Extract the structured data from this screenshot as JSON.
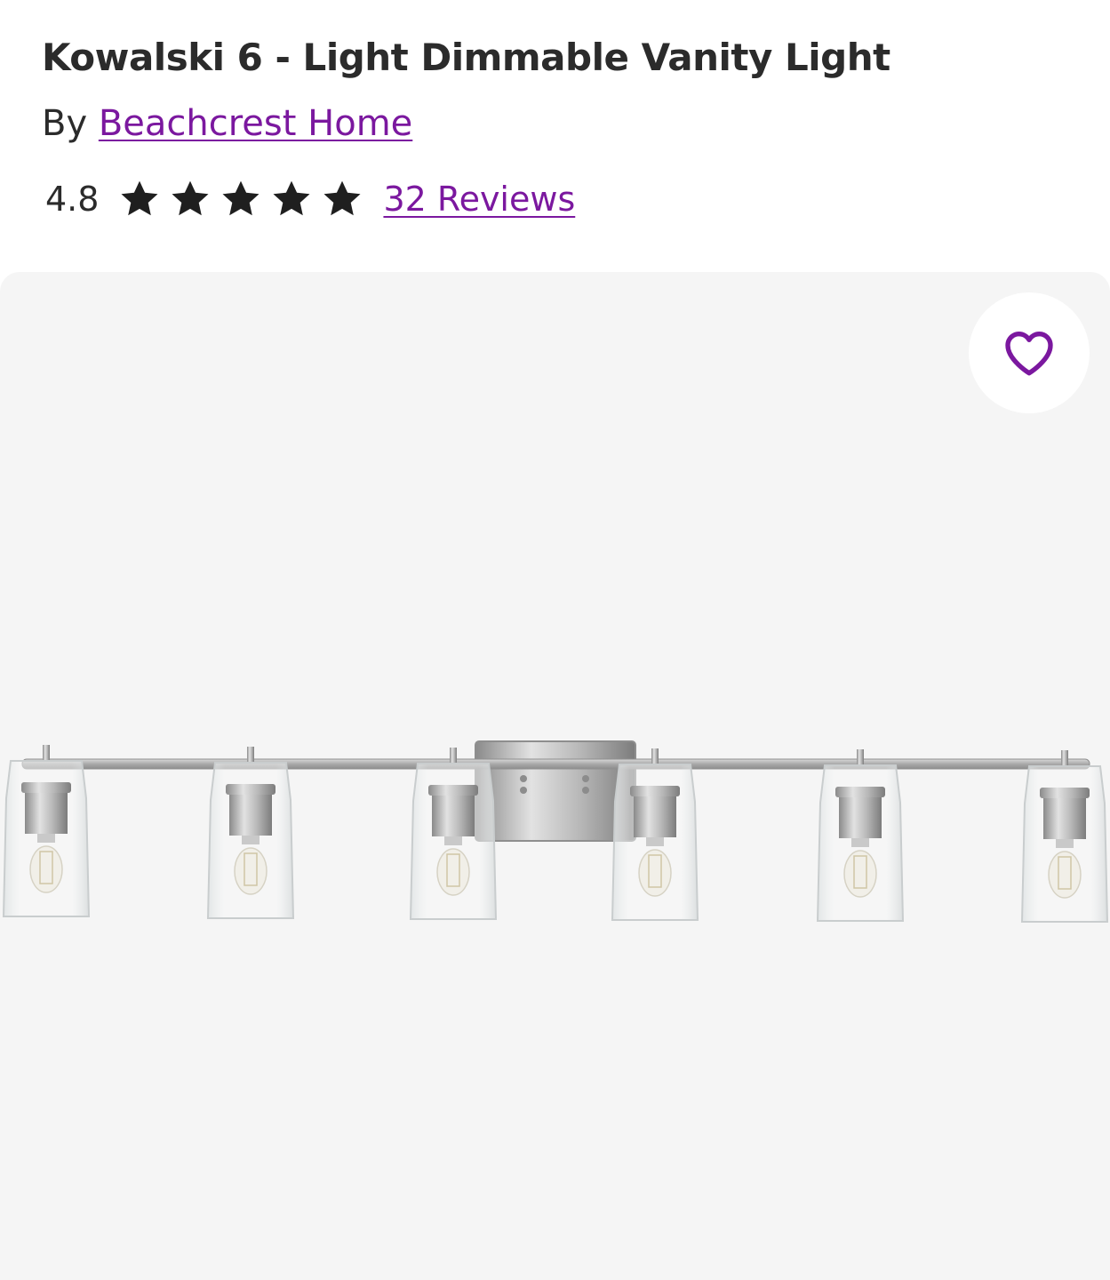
{
  "product": {
    "title": "Kowalski 6 - Light Dimmable Vanity Light",
    "by_prefix": "By",
    "brand": "Beachcrest Home",
    "rating": "4.8",
    "rating_stars": 4.8,
    "reviews_label": "32 Reviews"
  },
  "gallery": {
    "favorite_icon": "heart-outline-icon",
    "image_subject": "6-light brushed nickel vanity fixture with clear glass shades"
  },
  "colors": {
    "accent": "#7b189f",
    "text": "#2b2b2b",
    "star": "#1f1f1f",
    "image_bg": "#f5f5f5"
  }
}
